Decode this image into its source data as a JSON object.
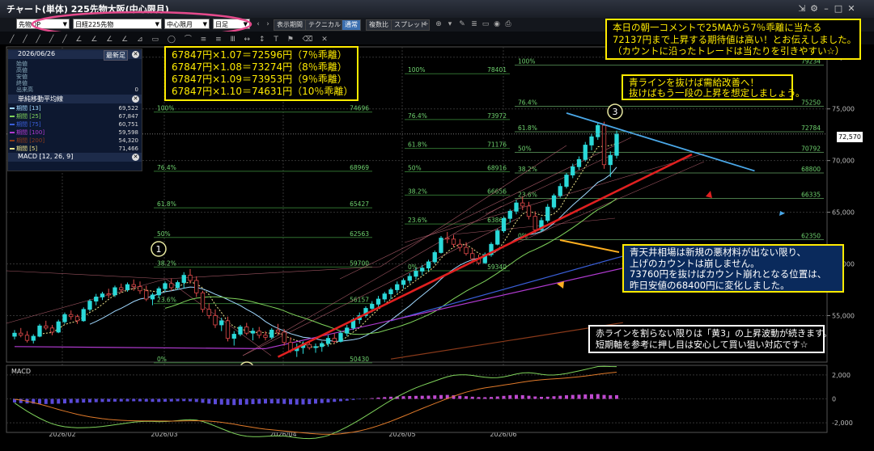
{
  "window": {
    "title": "チャート(単体) 225先物大阪(中心限月)",
    "icons": [
      "pin-icon",
      "settings-icon",
      "minimize-icon",
      "maximize-icon",
      "close-icon"
    ]
  },
  "toolbar": {
    "selects": [
      "先物OP",
      "日経225先物",
      "中心限月",
      "日足"
    ],
    "buttons": [
      "表示期間",
      "テクニカル",
      "通常",
      "複数比",
      "スプレッド"
    ]
  },
  "legend_panel": {
    "date": "2026/06/26",
    "latest_button": "最新足",
    "ohlc_labels": [
      "始値",
      "高値",
      "安値",
      "終値",
      "出来高"
    ],
    "volume_value": "0",
    "ma_title": "単純移動平均線",
    "ma_rows": [
      {
        "label": "期間 [13]",
        "value": "69,522",
        "color": "#a0d8ff"
      },
      {
        "label": "期間 [25]",
        "value": "67,847",
        "color": "#7fd35b"
      },
      {
        "label": "期間 [75]",
        "value": "60,751",
        "color": "#3a5fd9"
      },
      {
        "label": "期間 [100]",
        "value": "59,598",
        "color": "#b03ad0"
      },
      {
        "label": "期間 [200]",
        "value": "54,320",
        "color": "#8b3a1a"
      },
      {
        "label": "期間 [5]",
        "value": "71,466",
        "color": "#f0e68c"
      }
    ],
    "macd_label": "MACD [12, 26, 9]"
  },
  "notes": {
    "calc_lines": [
      "67847円×1.07＝72596円（7％乖離）",
      "67847円×1.08＝73274円（8％乖離）",
      "67847円×1.09＝73953円（9％乖離）",
      "67847円×1.10＝74631円（10％乖離）"
    ],
    "top_right": [
      "本日の朝一コメントで25MAから7％乖離に当たる",
      "72137円まで上昇する期待値は高い！とお伝えしました。",
      "（カウントに沿ったトレードは当たりを引きやすい☆）"
    ],
    "blue_line": [
      "青ラインを抜けば需給改善へ！",
      "抜けばもう一段の上昇を想定しましょう。"
    ],
    "ceiling": [
      "青天井相場は新規の悪材料が出ない限り、",
      "上げのカウントは崩しません。",
      "73760円を抜けばカウント崩れとなる位置は、",
      "昨日安値の68400円に変化しました。"
    ],
    "red_line": [
      "赤ラインを割らない限りは「黄3」の上昇波動が続きます。",
      "短期軸を参考に押し目は安心して買い狙い対応です☆"
    ]
  },
  "markers": {
    "m1": "1",
    "m2": "2",
    "m3": "3"
  },
  "current_price": "72,570",
  "chart_data": [
    {
      "type": "candlestick",
      "title": "",
      "x_ticks": [
        "2026/02",
        "2026/03",
        "2026/04",
        "2026/05",
        "2026/06"
      ],
      "y_ticks": [
        "80,000",
        "75,000",
        "70,000",
        "65,000",
        "60,000",
        "55,000"
      ],
      "ylim": [
        50500,
        81000
      ],
      "grid": true,
      "fib_sets": [
        {
          "levels": [
            {
              "pct": "100%",
              "value": "74696"
            },
            {
              "pct": "76.4%",
              "value": "68969"
            },
            {
              "pct": "61.8%",
              "value": "65427"
            },
            {
              "pct": "50%",
              "value": "62563"
            },
            {
              "pct": "38.2%",
              "value": "59700"
            },
            {
              "pct": "23.6%",
              "value": "56157"
            },
            {
              "pct": "0%",
              "value": "50430"
            }
          ]
        },
        {
          "levels": [
            {
              "pct": "100%",
              "value": "78401"
            },
            {
              "pct": "76.4%",
              "value": "73972"
            },
            {
              "pct": "61.8%",
              "value": "71176"
            },
            {
              "pct": "50%",
              "value": "68916"
            },
            {
              "pct": "38.2%",
              "value": "66656"
            },
            {
              "pct": "23.6%",
              "value": "63860"
            },
            {
              "pct": "0%",
              "value": "59340"
            }
          ]
        },
        {
          "levels": [
            {
              "pct": "100%",
              "value": "79234"
            },
            {
              "pct": "76.4%",
              "value": "75250"
            },
            {
              "pct": "61.8%",
              "value": "72784"
            },
            {
              "pct": "50%",
              "value": "70792"
            },
            {
              "pct": "38.2%",
              "value": "68800"
            },
            {
              "pct": "23.6%",
              "value": "66335"
            },
            {
              "pct": "0%",
              "value": "62350"
            }
          ]
        }
      ],
      "candles": [
        [
          53000,
          53600,
          52700,
          53300
        ],
        [
          53300,
          53800,
          52900,
          53100
        ],
        [
          53100,
          53500,
          52400,
          52600
        ],
        [
          52600,
          53200,
          52300,
          53000
        ],
        [
          53000,
          54200,
          52900,
          54000
        ],
        [
          54000,
          54500,
          53600,
          53800
        ],
        [
          53800,
          54100,
          53100,
          53400
        ],
        [
          53400,
          54600,
          53300,
          54400
        ],
        [
          54400,
          55300,
          54200,
          55100
        ],
        [
          55100,
          55500,
          54600,
          54900
        ],
        [
          54900,
          55100,
          54200,
          54500
        ],
        [
          54500,
          55800,
          54400,
          55600
        ],
        [
          55600,
          56600,
          55400,
          56400
        ],
        [
          56400,
          57100,
          56000,
          56800
        ],
        [
          56800,
          57300,
          56500,
          57100
        ],
        [
          57100,
          57600,
          56700,
          57000
        ],
        [
          57000,
          57900,
          56800,
          57700
        ],
        [
          57700,
          58100,
          57200,
          57500
        ],
        [
          57500,
          58200,
          57300,
          58000
        ],
        [
          58000,
          58500,
          57400,
          57800
        ],
        [
          57800,
          58300,
          57100,
          57400
        ],
        [
          57400,
          57900,
          56400,
          56600
        ],
        [
          56600,
          57200,
          56000,
          57000
        ],
        [
          57000,
          57800,
          56700,
          57600
        ],
        [
          57600,
          58300,
          57300,
          58100
        ],
        [
          58100,
          58600,
          57400,
          57700
        ],
        [
          57700,
          58400,
          57500,
          58200
        ],
        [
          58200,
          59200,
          57600,
          58900
        ],
        [
          58900,
          59500,
          58100,
          58400
        ],
        [
          58400,
          58800,
          56800,
          57200
        ],
        [
          57200,
          57400,
          55300,
          55600
        ],
        [
          55600,
          56200,
          54700,
          55000
        ],
        [
          55000,
          55600,
          53800,
          54100
        ],
        [
          54100,
          54800,
          53500,
          54500
        ],
        [
          54500,
          54900,
          52500,
          52800
        ],
        [
          52800,
          53500,
          52100,
          53200
        ],
        [
          53200,
          54100,
          53000,
          53900
        ],
        [
          53900,
          54300,
          53100,
          53300
        ],
        [
          53300,
          53800,
          52600,
          53500
        ],
        [
          53500,
          53900,
          52800,
          53100
        ],
        [
          53100,
          53500,
          52600,
          52900
        ],
        [
          52900,
          53800,
          52700,
          53600
        ],
        [
          53600,
          54200,
          53100,
          53400
        ],
        [
          53400,
          53700,
          52100,
          52400
        ],
        [
          52400,
          52900,
          51400,
          51600
        ],
        [
          51600,
          52300,
          51000,
          51900
        ],
        [
          51900,
          52500,
          51300,
          52200
        ],
        [
          52200,
          52600,
          51700,
          51900
        ],
        [
          51900,
          52300,
          51400,
          52000
        ],
        [
          52000,
          52500,
          51500,
          52300
        ],
        [
          52300,
          53100,
          52000,
          52800
        ],
        [
          52800,
          53300,
          52300,
          52500
        ],
        [
          52500,
          53500,
          52400,
          53300
        ],
        [
          53300,
          54100,
          53000,
          53800
        ],
        [
          53800,
          54800,
          53600,
          54600
        ],
        [
          54600,
          55300,
          54200,
          55000
        ],
        [
          55000,
          55900,
          54800,
          55700
        ],
        [
          55700,
          56400,
          55300,
          56100
        ],
        [
          56100,
          56900,
          55800,
          56600
        ],
        [
          56600,
          57300,
          56300,
          57100
        ],
        [
          57100,
          57700,
          56600,
          57500
        ],
        [
          57500,
          58300,
          57200,
          58000
        ],
        [
          58000,
          58600,
          57600,
          58400
        ],
        [
          58400,
          59100,
          58100,
          58800
        ],
        [
          58800,
          59600,
          58500,
          59300
        ],
        [
          59300,
          59900,
          58900,
          59600
        ],
        [
          59600,
          60400,
          59300,
          60200
        ],
        [
          60200,
          61300,
          60000,
          61100
        ],
        [
          61100,
          62700,
          61000,
          62500
        ],
        [
          62500,
          63100,
          62000,
          62400
        ],
        [
          62400,
          62800,
          61600,
          61900
        ],
        [
          61900,
          62400,
          61200,
          61600
        ],
        [
          61600,
          62100,
          60800,
          61000
        ],
        [
          61000,
          61500,
          60200,
          60500
        ],
        [
          60500,
          60900,
          59900,
          60100
        ],
        [
          60100,
          61100,
          60000,
          60900
        ],
        [
          60900,
          62100,
          60700,
          61900
        ],
        [
          61900,
          63400,
          61800,
          63200
        ],
        [
          63200,
          64600,
          63000,
          64400
        ],
        [
          64400,
          65300,
          64000,
          65100
        ],
        [
          65100,
          66200,
          64800,
          65900
        ],
        [
          65900,
          66500,
          65200,
          65600
        ],
        [
          65600,
          66000,
          64300,
          64600
        ],
        [
          64600,
          65100,
          63000,
          63300
        ],
        [
          63300,
          64500,
          63100,
          64200
        ],
        [
          64200,
          65800,
          64000,
          65500
        ],
        [
          65500,
          66800,
          65300,
          66600
        ],
        [
          66600,
          67800,
          66400,
          67500
        ],
        [
          67500,
          68800,
          67300,
          68600
        ],
        [
          68600,
          69700,
          68300,
          69400
        ],
        [
          69400,
          70400,
          69100,
          70100
        ],
        [
          70100,
          71800,
          69900,
          71500
        ],
        [
          71500,
          72600,
          71000,
          72300
        ],
        [
          72300,
          73700,
          72000,
          73400
        ],
        [
          73400,
          73760,
          69200,
          69600
        ],
        [
          69600,
          70900,
          68400,
          70500
        ],
        [
          70500,
          72900,
          70200,
          72570
        ]
      ],
      "ma_series": [
        {
          "name": "期間 [5]",
          "color": "#f0e68c",
          "period": 5
        },
        {
          "name": "期間 [13]",
          "color": "#a0d8ff",
          "period": 13
        },
        {
          "name": "期間 [25]",
          "color": "#7fd35b",
          "period": 25
        },
        {
          "name": "期間 [75]",
          "color": "#3a5fd9",
          "values": [
            [
              60,
              54500
            ],
            [
              97,
              60751
            ]
          ]
        },
        {
          "name": "期間 [100]",
          "color": "#b03ad0",
          "values": [
            [
              0,
              52000
            ],
            [
              40,
              51800
            ],
            [
              97,
              59598
            ]
          ]
        },
        {
          "name": "期間 [200]",
          "color": "#8b3a1a",
          "values": [
            [
              60,
              50800
            ],
            [
              97,
              54320
            ]
          ]
        }
      ],
      "trendlines": [
        {
          "name": "red",
          "color": "#e02020",
          "from": [
            42,
            51000
          ],
          "to": [
            108,
            70600
          ]
        },
        {
          "name": "blue",
          "color": "#4aa8e8",
          "from": [
            88,
            74600
          ],
          "to": [
            118,
            69000
          ]
        }
      ]
    },
    {
      "type": "bar",
      "title": "MACD",
      "y_ticks": [
        "2,000",
        "0",
        "-2,000"
      ],
      "ylim": [
        -2800,
        2800
      ],
      "lines": [
        {
          "name": "MACD",
          "color": "#7fd35b"
        },
        {
          "name": "Signal",
          "color": "#e07a2a"
        }
      ],
      "hist": [
        -300,
        -350,
        -380,
        -400,
        -420,
        -430,
        -420,
        -400,
        -380,
        -350,
        -330,
        -310,
        -300,
        -280,
        -260,
        -240,
        -230,
        -220,
        -210,
        -200,
        -210,
        -230,
        -250,
        -260,
        -240,
        -220,
        -200,
        -190,
        -210,
        -260,
        -330,
        -400,
        -450,
        -480,
        -500,
        -520,
        -500,
        -470,
        -440,
        -410,
        -390,
        -380,
        -390,
        -420,
        -460,
        -480,
        -470,
        -440,
        -400,
        -350,
        -300,
        -250,
        -200,
        -150,
        -90,
        -40,
        10,
        60,
        110,
        150,
        180,
        200,
        220,
        240,
        250,
        260,
        270,
        290,
        320,
        330,
        300,
        260,
        220,
        180,
        150,
        140,
        160,
        200,
        250,
        300,
        330,
        310,
        260,
        200,
        170,
        180,
        220,
        260,
        300,
        330,
        350,
        370,
        390,
        400,
        330,
        300,
        310
      ]
    }
  ]
}
